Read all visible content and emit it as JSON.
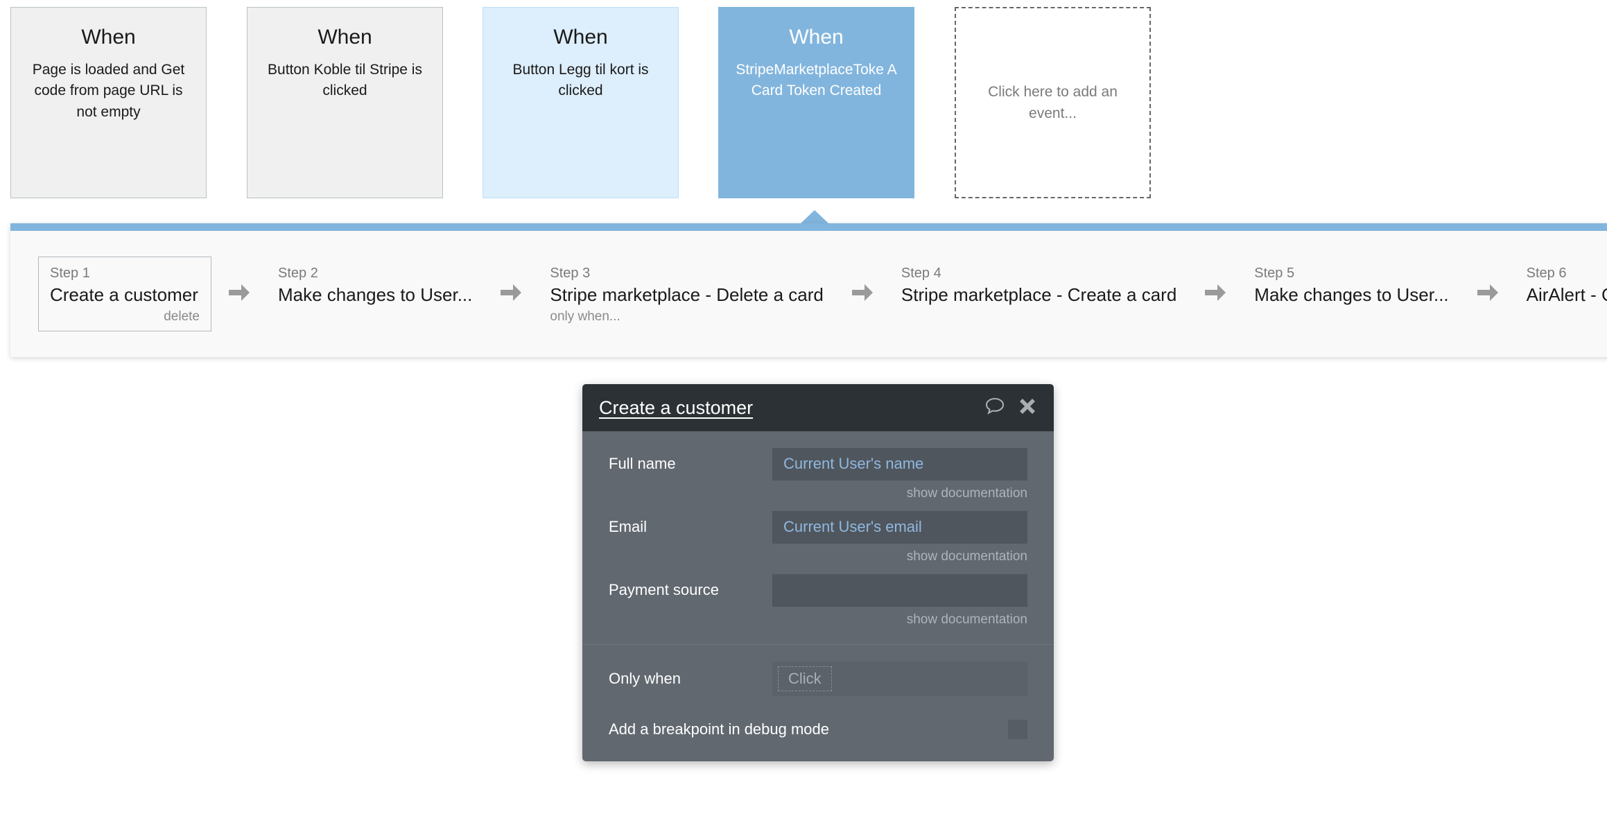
{
  "events": [
    {
      "when_label": "When",
      "description": "Page is loaded and Get code from page URL is not empty",
      "state": "plain"
    },
    {
      "when_label": "When",
      "description": "Button Koble til Stripe is clicked",
      "state": "plain"
    },
    {
      "when_label": "When",
      "description": "Button Legg til kort is clicked",
      "state": "light"
    },
    {
      "when_label": "When",
      "description": "StripeMarketplaceToke A Card Token Created",
      "state": "selected"
    }
  ],
  "add_event_placeholder": "Click here to add an event...",
  "workflow": {
    "steps": [
      {
        "label": "Step 1",
        "title": "Create a customer",
        "sub": "delete",
        "framed": true
      },
      {
        "label": "Step 2",
        "title": "Make changes to User...",
        "sub": "",
        "framed": false
      },
      {
        "label": "Step 3",
        "title": "Stripe marketplace - Delete a card",
        "sub": "only when...",
        "framed": false
      },
      {
        "label": "Step 4",
        "title": "Stripe marketplace - Create a card",
        "sub": "",
        "framed": false
      },
      {
        "label": "Step 5",
        "title": "Make changes to User...",
        "sub": "",
        "framed": false
      },
      {
        "label": "Step 6",
        "title": "AirAlert - Custom",
        "sub": "",
        "framed": false
      }
    ],
    "arrow_icon": "arrow-right-icon"
  },
  "modal": {
    "title": "Create a customer",
    "comment_icon": "comment-bubble-icon",
    "close_icon": "close-icon",
    "fields": [
      {
        "label": "Full name",
        "value": "Current User's name",
        "doc_link": "show documentation"
      },
      {
        "label": "Email",
        "value": "Current User's email",
        "doc_link": "show documentation"
      },
      {
        "label": "Payment source",
        "value": "",
        "doc_link": "show documentation"
      }
    ],
    "only_when": {
      "label": "Only when",
      "placeholder": "Click"
    },
    "breakpoint": {
      "label": "Add a breakpoint in debug mode",
      "checked": false
    }
  },
  "colors": {
    "accent_blue": "#82b5dd",
    "light_blue": "#ddeefc",
    "modal_header": "#2b3135",
    "modal_body": "#616870",
    "dynamic_text": "#8fb8e0"
  }
}
